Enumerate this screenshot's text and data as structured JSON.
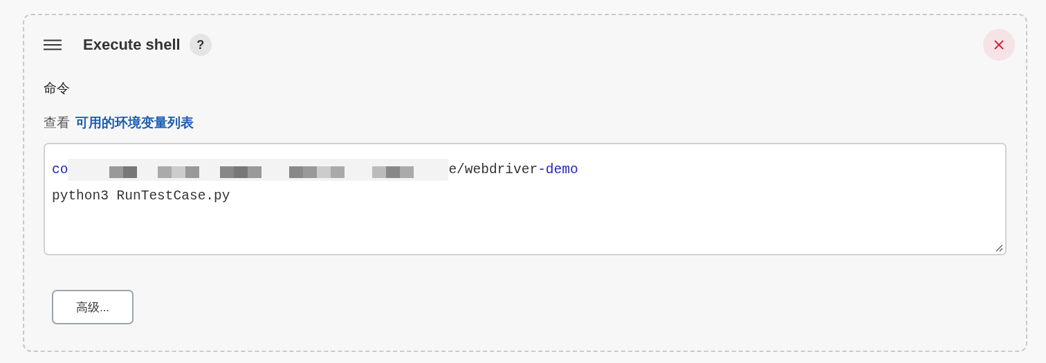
{
  "step": {
    "title": "Execute shell",
    "help": "?"
  },
  "field": {
    "label": "命令",
    "hint_prefix": "查看",
    "hint_link": "可用的环境变量列表"
  },
  "code_lines": [
    {
      "tokens": [
        {
          "kind": "keyword",
          "text": "co"
        },
        {
          "kind": "redacted"
        },
        {
          "kind": "plain",
          "text": "e/webdriver"
        },
        {
          "kind": "keyword",
          "text": "-demo"
        }
      ]
    },
    {
      "tokens": [
        {
          "kind": "plain",
          "text": "python3 RunTestCase.py"
        }
      ]
    }
  ],
  "advanced_button": "高级..."
}
